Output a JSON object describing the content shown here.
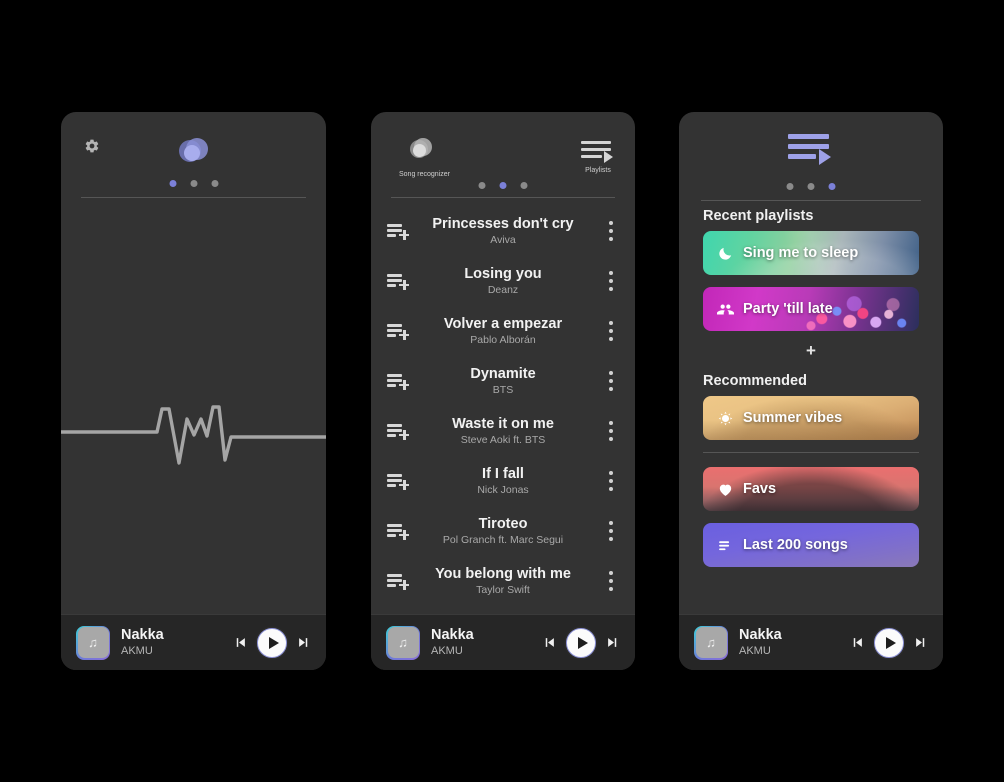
{
  "app": {
    "background": "#000000",
    "panel_background": "#333333",
    "accent": "#7b80d8"
  },
  "now_playing": {
    "title": "Nakka",
    "artist": "AKMU",
    "art_icon": "music-note-icon",
    "prev_icon": "skip-previous-icon",
    "play_icon": "play-icon",
    "next_icon": "skip-next-icon"
  },
  "panel_recognizer": {
    "settings_icon": "gear-icon",
    "orb_icon": "song-recognizer-orb-icon",
    "waveform_icon": "waveform-icon",
    "dots": [
      {
        "active": true
      },
      {
        "active": false
      },
      {
        "active": false
      }
    ]
  },
  "panel_songs": {
    "recognizer_label": "Song recognizer",
    "recognizer_icon": "song-recognizer-orb-icon",
    "playlists_label": "Playlists",
    "playlists_icon": "playlist-icon",
    "dots": [
      {
        "active": false
      },
      {
        "active": true
      },
      {
        "active": false
      }
    ],
    "row_add_icon": "add-to-playlist-icon",
    "row_menu_icon": "more-options-icon",
    "songs": [
      {
        "title": "Princesses don't cry",
        "artist": "Aviva"
      },
      {
        "title": "Losing you",
        "artist": "Deanz"
      },
      {
        "title": "Volver a empezar",
        "artist": "Pablo Alborán"
      },
      {
        "title": "Dynamite",
        "artist": "BTS"
      },
      {
        "title": "Waste it on me",
        "artist": "Steve Aoki ft. BTS"
      },
      {
        "title": "If I fall",
        "artist": "Nick Jonas"
      },
      {
        "title": "Tiroteo",
        "artist": "Pol Granch ft. Marc Segui"
      },
      {
        "title": "You belong with me",
        "artist": "Taylor Swift"
      }
    ]
  },
  "panel_playlists": {
    "header_icon": "playlist-icon",
    "dots": [
      {
        "active": false
      },
      {
        "active": false
      },
      {
        "active": true
      }
    ],
    "recent_title": "Recent playlists",
    "recent": [
      {
        "name": "Sing me to sleep",
        "icon": "moon-icon",
        "color": "#3fd8b0"
      },
      {
        "name": "Party 'till late",
        "icon": "people-icon",
        "color": "#d93fd1"
      }
    ],
    "add_label": "+",
    "recommended_title": "Recommended",
    "recommended": [
      {
        "name": "Summer vibes",
        "icon": "sun-icon",
        "color": "#e8bb6d"
      }
    ],
    "library": [
      {
        "name": "Favs",
        "icon": "heart-icon",
        "color": "#e06b6b"
      },
      {
        "name": "Last 200 songs",
        "icon": "list-icon",
        "color": "#6a62d8"
      }
    ]
  }
}
